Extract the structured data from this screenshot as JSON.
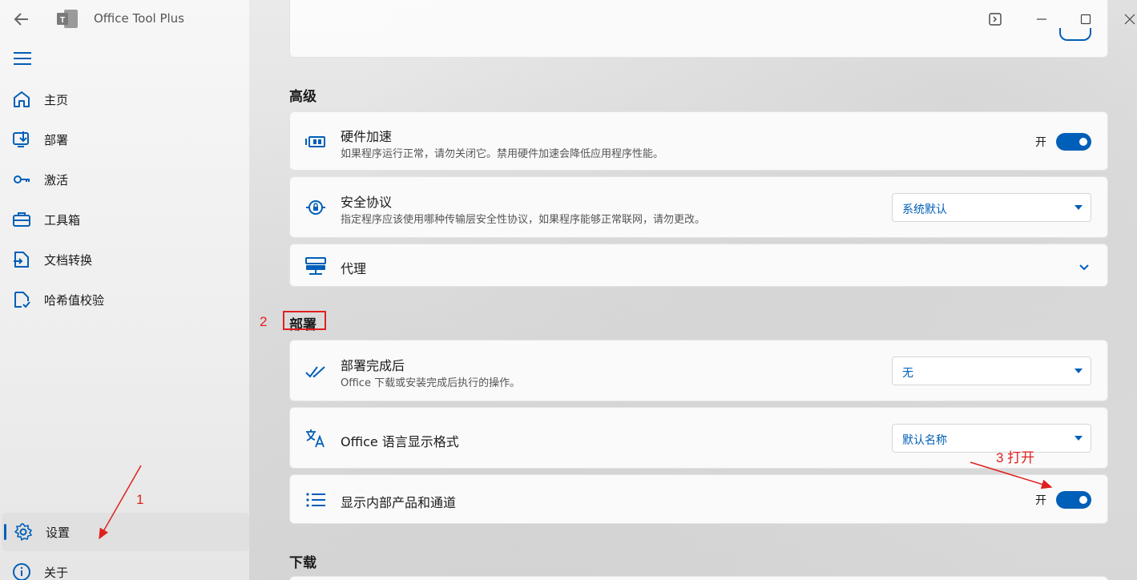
{
  "app": {
    "title": "Office Tool Plus"
  },
  "nav": {
    "items": [
      {
        "label": "主页",
        "icon": "home-icon"
      },
      {
        "label": "部署",
        "icon": "deploy-icon"
      },
      {
        "label": "激活",
        "icon": "key-icon"
      },
      {
        "label": "工具箱",
        "icon": "toolbox-icon"
      },
      {
        "label": "文档转换",
        "icon": "doc-convert-icon"
      },
      {
        "label": "哈希值校验",
        "icon": "hash-check-icon"
      }
    ],
    "settings": {
      "label": "设置",
      "icon": "gear-icon"
    },
    "about": {
      "label": "关于",
      "icon": "info-icon"
    }
  },
  "sections": {
    "advanced": "高级",
    "deploy": "部署",
    "download": "下载"
  },
  "cards": {
    "hw": {
      "title": "硬件加速",
      "desc": "如果程序运行正常，请勿关闭它。禁用硬件加速会降低应用程序性能。",
      "toggle_label": "开"
    },
    "security": {
      "title": "安全协议",
      "desc": "指定程序应该使用哪种传输层安全性协议，如果程序能够正常联网，请勿更改。",
      "select_value": "系统默认"
    },
    "proxy": {
      "title": "代理"
    },
    "after_deploy": {
      "title": "部署完成后",
      "desc": "Office 下载或安装完成后执行的操作。",
      "select_value": "无"
    },
    "lang_format": {
      "title": "Office 语言显示格式",
      "select_value": "默认名称"
    },
    "internal": {
      "title": "显示内部产品和通道",
      "toggle_label": "开"
    }
  },
  "annotations": {
    "one": "1",
    "two": "2",
    "three": "3 打开"
  },
  "colors": {
    "accent": "#005fb8",
    "annotation": "#e02020"
  }
}
